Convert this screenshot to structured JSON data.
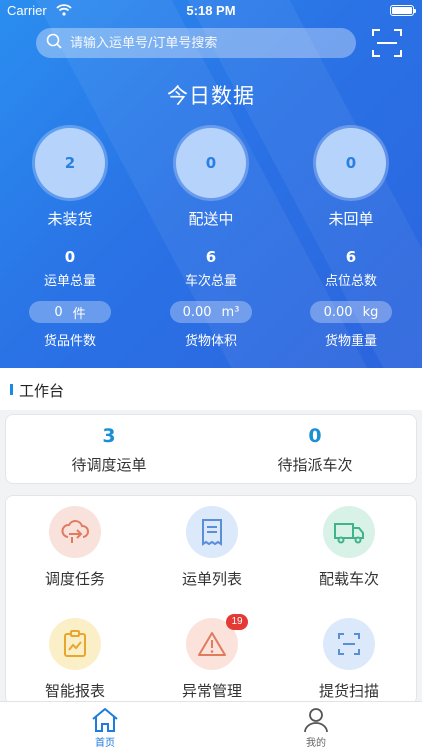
{
  "status_bar": {
    "carrier": "Carrier",
    "time": "5:18 PM"
  },
  "search": {
    "placeholder": "请输入运单号/订单号搜索"
  },
  "header": {
    "title": "今日数据"
  },
  "circles": [
    {
      "value": "2",
      "label": "未装货"
    },
    {
      "value": "0",
      "label": "配送中"
    },
    {
      "value": "0",
      "label": "未回单"
    }
  ],
  "stats": [
    {
      "value": "0",
      "label": "运单总量"
    },
    {
      "value": "6",
      "label": "车次总量"
    },
    {
      "value": "6",
      "label": "点位总数"
    }
  ],
  "measures": [
    {
      "value": "0",
      "unit": "件",
      "label": "货品件数"
    },
    {
      "value": "0.00",
      "unit": "m³",
      "label": "货物体积"
    },
    {
      "value": "0.00",
      "unit": "kg",
      "label": "货物重量"
    }
  ],
  "workbench": {
    "title": "工作台",
    "pending": [
      {
        "value": "3",
        "label": "待调度运单"
      },
      {
        "value": "0",
        "label": "待指派车次"
      }
    ],
    "functions": [
      {
        "label": "调度任务",
        "icon": "dispatch-icon",
        "color": "#f9e1dc",
        "stroke": "#e07b5f"
      },
      {
        "label": "运单列表",
        "icon": "waybill-list-icon",
        "color": "#dbe9fb",
        "stroke": "#5a8fd8"
      },
      {
        "label": "配载车次",
        "icon": "truck-icon",
        "color": "#d9f2e7",
        "stroke": "#3fb48a"
      },
      {
        "label": "智能报表",
        "icon": "report-icon",
        "color": "#fbefc8",
        "stroke": "#e9a62f"
      },
      {
        "label": "异常管理",
        "icon": "warning-icon",
        "color": "#fbe3dc",
        "stroke": "#e07b5f",
        "badge": "19"
      },
      {
        "label": "提货扫描",
        "icon": "scan-icon",
        "color": "#dbe9fb",
        "stroke": "#5a8fd8"
      }
    ]
  },
  "tabs": [
    {
      "label": "首页",
      "icon": "home-icon",
      "active": true,
      "color": "#1e7be0"
    },
    {
      "label": "我的",
      "icon": "profile-icon",
      "active": false,
      "color": "#666666"
    }
  ]
}
